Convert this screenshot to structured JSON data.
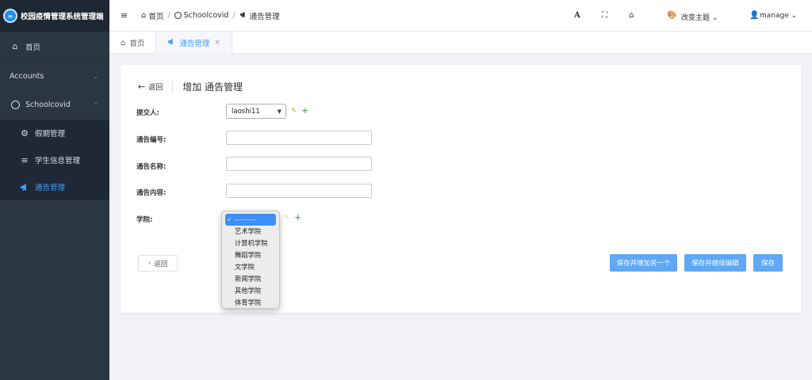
{
  "brand": {
    "logo_glyph": "∞",
    "title": "校园疫情管理系统管理端"
  },
  "sidebar": {
    "items": [
      {
        "label": "首页",
        "icon": "home-icon"
      },
      {
        "label": "Accounts",
        "icon": ""
      },
      {
        "label": "Schoolcovid",
        "icon": "circle-icon"
      },
      {
        "label": "假期管理",
        "icon": "gear-icon"
      },
      {
        "label": "学生信息管理",
        "icon": "database-icon"
      },
      {
        "label": "通告管理",
        "icon": "megaphone-icon"
      }
    ],
    "active_color": "#409eff"
  },
  "topbar": {
    "breadcrumb": [
      "首页",
      "Schoolcovid",
      "通告管理"
    ],
    "theme_label": "改变主题",
    "user_label": "manage"
  },
  "tabs": [
    {
      "label": "首页"
    },
    {
      "label": "通告管理",
      "close": "×"
    }
  ],
  "form": {
    "back_link": "返回",
    "title": "增加 通告管理",
    "fields": {
      "submitter_label": "提交人:",
      "submitter_value": "laoshi11",
      "number_label": "通告编号:",
      "name_label": "通告名称:",
      "content_label": "通告内容:",
      "college_label": "学院:"
    },
    "buttons": {
      "back": "返回",
      "save_add": "保存并增加另一个",
      "save_continue": "保存并继续编辑",
      "save": "保存"
    }
  },
  "dropdown": {
    "options": [
      "---------",
      "艺术学院",
      "计算机学院",
      "舞蹈学院",
      "文学院",
      "新闻学院",
      "其他学院",
      "体育学院"
    ],
    "selected_index": 0
  }
}
